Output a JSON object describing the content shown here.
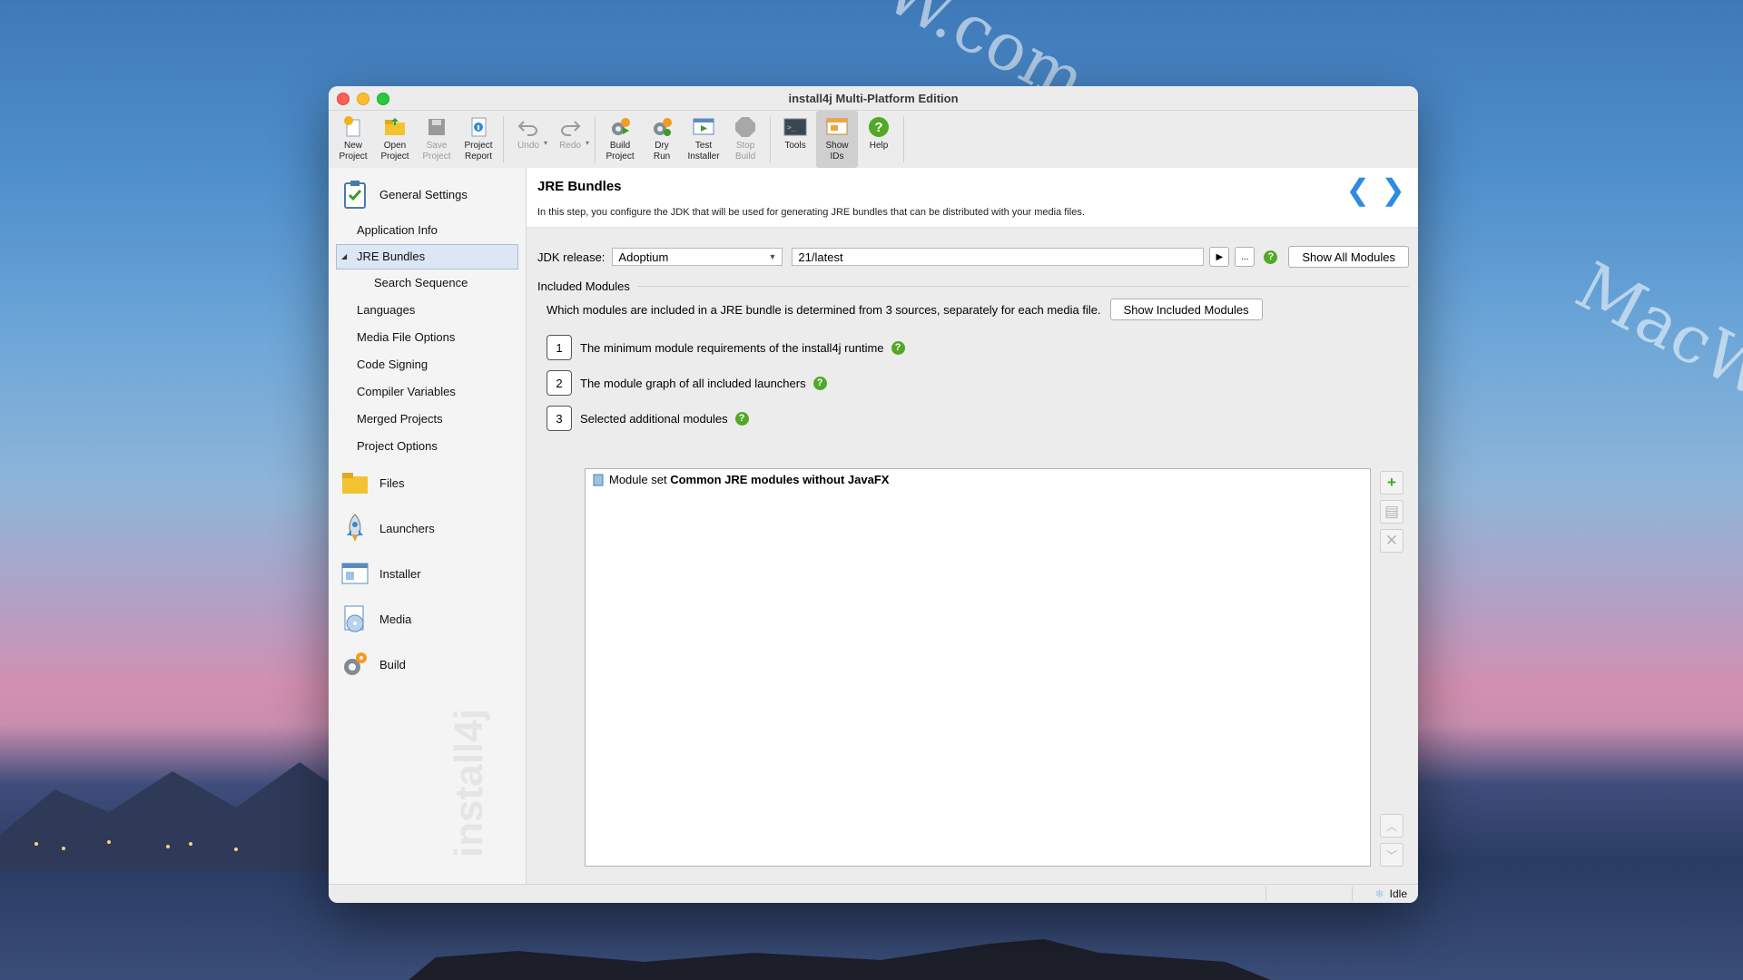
{
  "watermarks": {
    "brand": "MacW.com",
    "vertical": "install4j"
  },
  "window": {
    "title": "install4j Multi-Platform Edition"
  },
  "toolbar": [
    {
      "label": "New\nProject",
      "icon": "new-project-icon",
      "enabled": true
    },
    {
      "label": "Open\nProject",
      "icon": "open-project-icon",
      "enabled": true
    },
    {
      "label": "Save\nProject",
      "icon": "save-project-icon",
      "enabled": false
    },
    {
      "label": "Project\nReport",
      "icon": "project-report-icon",
      "enabled": true
    },
    {
      "label": "Undo",
      "icon": "undo-icon",
      "enabled": false
    },
    {
      "label": "Redo",
      "icon": "redo-icon",
      "enabled": false
    },
    {
      "label": "Build\nProject",
      "icon": "build-project-icon",
      "enabled": true
    },
    {
      "label": "Dry\nRun",
      "icon": "dry-run-icon",
      "enabled": true
    },
    {
      "label": "Test\nInstaller",
      "icon": "test-installer-icon",
      "enabled": true
    },
    {
      "label": "Stop\nBuild",
      "icon": "stop-build-icon",
      "enabled": false
    },
    {
      "label": "Tools",
      "icon": "tools-icon",
      "enabled": true
    },
    {
      "label": "Show\nIDs",
      "icon": "show-ids-icon",
      "enabled": true,
      "active": true
    },
    {
      "label": "Help",
      "icon": "help-icon",
      "enabled": true
    }
  ],
  "sidebar": {
    "general": "General Settings",
    "items": [
      "Application Info",
      "JRE Bundles",
      "Search Sequence",
      "Languages",
      "Media File Options",
      "Code Signing",
      "Compiler Variables",
      "Merged Projects",
      "Project Options"
    ],
    "sections": [
      "Files",
      "Launchers",
      "Installer",
      "Media",
      "Build"
    ]
  },
  "main": {
    "title": "JRE Bundles",
    "description": "In this step, you configure the JDK that will be used for generating JRE bundles that can be distributed with your media files.",
    "jdk_label": "JDK release:",
    "jdk_vendor": "Adoptium",
    "jdk_version": "21/latest",
    "browse": "...",
    "show_all_modules": "Show All Modules",
    "included_modules": "Included Modules",
    "sources_text": "Which modules are included in a JRE bundle is determined from 3 sources, separately for each media file.",
    "show_included_modules": "Show Included Modules",
    "sources": [
      {
        "n": "1",
        "text": "The minimum module requirements of the install4j runtime"
      },
      {
        "n": "2",
        "text": "The module graph of all included launchers"
      },
      {
        "n": "3",
        "text": "Selected additional modules"
      }
    ],
    "module_prefix": "Module set ",
    "module_name": "Common JRE modules without JavaFX"
  },
  "status": {
    "text": "Idle"
  },
  "colors": {
    "accent": "#2d8be0",
    "help_green": "#52a827",
    "selection": "#dce6f4"
  }
}
